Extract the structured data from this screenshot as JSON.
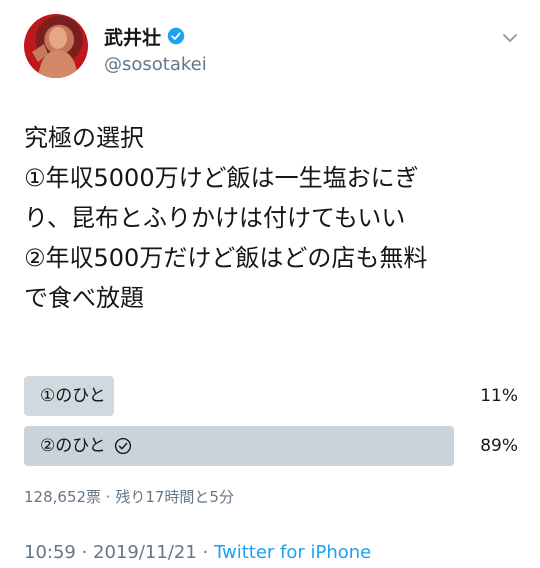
{
  "user": {
    "name": "武井壮",
    "handle": "@sosotakei"
  },
  "tweet": {
    "lines": [
      "究極の選択",
      "①年収5000万けど飯は一生塩おにぎ",
      "り、昆布とふりかけは付けてもいい",
      "②年収500万だけど飯はどの店も無料",
      "で食べ放題"
    ]
  },
  "poll": {
    "options": [
      {
        "label": "①のひと",
        "percent_text": "11%",
        "percent": 11,
        "selected": false
      },
      {
        "label": "②のひと",
        "percent_text": "89%",
        "percent": 89,
        "selected": true
      }
    ],
    "meta": "128,652票 · 残り17時間と5分"
  },
  "footer": {
    "time": "10:59",
    "separator": " · ",
    "date": "2019/11/21",
    "source": "Twitter for iPhone"
  },
  "colors": {
    "text": "#14171a",
    "muted": "#657786",
    "accent": "#1da1f2",
    "bar": "#cfd9de"
  },
  "icons": {
    "verified": "verified-badge-icon",
    "more": "chevron-down-icon",
    "selected": "check-circle-icon"
  }
}
